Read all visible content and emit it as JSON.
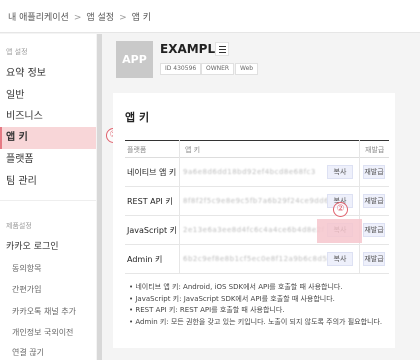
{
  "breadcrumb": [
    "내 애플리케이션",
    "앱 설정",
    "앱 키"
  ],
  "sidebar": {
    "section_app_settings": "앱 설정",
    "items": [
      "요약 정보",
      "일반",
      "비즈니스",
      "앱 키",
      "플랫폼",
      "팀 관리"
    ],
    "active_index": 3,
    "section_product_settings": "제품설정",
    "kakao_login": "카카오 로그인",
    "sub_items": [
      "동의항목",
      "간편가입",
      "카카오톡 채널 추가",
      "개인정보 국외이전",
      "연결 끊기"
    ]
  },
  "annotations": {
    "marker_1": "①",
    "marker_2": "②"
  },
  "app": {
    "logo_text": "APP",
    "name": "EXAMPLE",
    "tags": [
      "ID 430596",
      "OWNER",
      "Web"
    ]
  },
  "card": {
    "title": "앱 키",
    "columns": {
      "platform": "플랫폼",
      "key": "앱 키",
      "reissue": "재발급"
    },
    "rows": [
      {
        "platform": "네이티브 앱 키",
        "key": "9a6e8d6dd18bd92ef4bcd8e68fc3",
        "copy": "복사",
        "reissue": "재발급"
      },
      {
        "platform": "REST API 키",
        "key": "8f8f2f5c9e8e9c5fb7a6b29f24ce9dd6a",
        "copy": "복사",
        "reissue": "재발급"
      },
      {
        "platform": "JavaScript 키",
        "key": "2e13e6a3ee8d4fc6c4a4ce6b4d8e2f",
        "copy": "복사",
        "reissue": "재발급"
      },
      {
        "platform": "Admin 키",
        "key": "6b2c9ef8e8b1cf5ec0e8f12a9b6c8d5e6",
        "copy": "복사",
        "reissue": "재발급"
      }
    ],
    "notes": [
      "• 네이티브 앱 키: Android, iOS SDK에서 API를 호출할 때 사용합니다.",
      "• JavaScript 키: JavaScript SDK에서 API를 호출할 때 사용합니다.",
      "• REST API 키: REST API를 호출할 때 사용합니다.",
      "• Admin 키: 모든 권한을 갖고 있는 키입니다. 노출이 되지 않도록 주의가 필요합니다."
    ]
  }
}
